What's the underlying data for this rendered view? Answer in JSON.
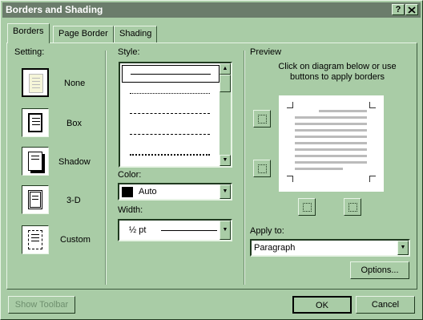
{
  "window": {
    "title": "Borders and Shading",
    "help_button": "?",
    "close_button": "x"
  },
  "tabs": [
    {
      "label": "Borders",
      "active": true
    },
    {
      "label": "Page Border",
      "active": false
    },
    {
      "label": "Shading",
      "active": false
    }
  ],
  "setting": {
    "heading": "Setting:",
    "options": [
      {
        "label": "None",
        "selected": true
      },
      {
        "label": "Box",
        "selected": false
      },
      {
        "label": "Shadow",
        "selected": false
      },
      {
        "label": "3-D",
        "selected": false
      },
      {
        "label": "Custom",
        "selected": false
      }
    ]
  },
  "style": {
    "heading": "Style:",
    "color_label": "Color:",
    "color_value": "Auto",
    "color_swatch": "#000000",
    "width_label": "Width:",
    "width_value": "½ pt"
  },
  "preview": {
    "heading": "Preview",
    "instructions": "Click on diagram below or use buttons to apply borders",
    "apply_to_label": "Apply to:",
    "apply_to_value": "Paragraph",
    "options_button": "Options..."
  },
  "footer": {
    "show_toolbar": "Show Toolbar",
    "ok": "OK",
    "cancel": "Cancel"
  }
}
